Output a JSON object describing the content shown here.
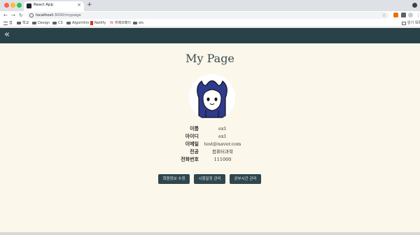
{
  "browser": {
    "tab_title": "React App",
    "new_tab_glyph": "+",
    "close_glyph": "×",
    "url_host": "localhost:",
    "url_path": "3000/mypage",
    "nav": {
      "back": "←",
      "forward": "→",
      "reload": "↻",
      "star": "☆",
      "kebab": "⋮"
    },
    "bookmarks": [
      {
        "label": "앱",
        "icon": "apps-icon"
      },
      {
        "label": "학교",
        "icon": "folder-icon"
      },
      {
        "label": "Design",
        "icon": "folder-icon"
      },
      {
        "label": "CS",
        "icon": "folder-icon"
      },
      {
        "label": "Algorithm",
        "icon": "folder-icon"
      },
      {
        "label": "Netlify",
        "icon": "netlify-icon"
      },
      {
        "label": "위메프페이",
        "icon": "notion-icon"
      },
      {
        "label": "etc",
        "icon": "folder-icon"
      }
    ],
    "reading_list": "읽기 목록"
  },
  "header": {
    "back_glyph": "«"
  },
  "page": {
    "title": "My Page",
    "profile": {
      "rows": [
        {
          "label": "이름",
          "value": "ex1"
        },
        {
          "label": "아이디",
          "value": "ex1"
        },
        {
          "label": "이메일",
          "value": "test@naver.com"
        },
        {
          "label": "전공",
          "value": "컴퓨터과학"
        },
        {
          "label": "전화번호",
          "value": "111000"
        }
      ]
    },
    "buttons": [
      "회원정보 수정",
      "시험일정 관리",
      "공부시간 관리"
    ]
  },
  "colors": {
    "header_bg": "#294149",
    "page_bg": "#fbf7ea",
    "button_bg": "#2f464e",
    "avatar_hair": "#2e3a8c"
  }
}
